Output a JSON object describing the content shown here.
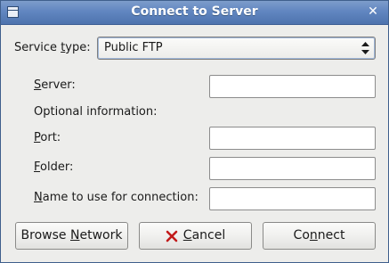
{
  "window": {
    "title": "Connect to Server"
  },
  "service": {
    "label_pre": "Service ",
    "label_mnemonic": "t",
    "label_post": "ype:",
    "selected": "Public FTP"
  },
  "fields": {
    "server": {
      "mnemonic": "S",
      "rest": "erver:",
      "value": ""
    },
    "optional_heading": "Optional information:",
    "port": {
      "mnemonic": "P",
      "rest": "ort:",
      "value": ""
    },
    "folder": {
      "mnemonic": "F",
      "rest": "older:",
      "value": ""
    },
    "name": {
      "mnemonic": "N",
      "rest": "ame to use for connection:",
      "value": ""
    }
  },
  "buttons": {
    "browse": {
      "pre": "Browse ",
      "mnemonic": "N",
      "post": "etwork"
    },
    "cancel": {
      "mnemonic": "C",
      "post": "ancel"
    },
    "connect": {
      "pre": "Co",
      "mnemonic": "n",
      "post": "nect"
    }
  },
  "icons": {
    "window_menu": "window-menu-icon",
    "close": "close-icon",
    "combo_arrows": "combo-arrows-icon",
    "cancel": "cancel-icon"
  },
  "colors": {
    "titlebar": "#6186c0",
    "cancel_icon": "#c21a1a"
  }
}
